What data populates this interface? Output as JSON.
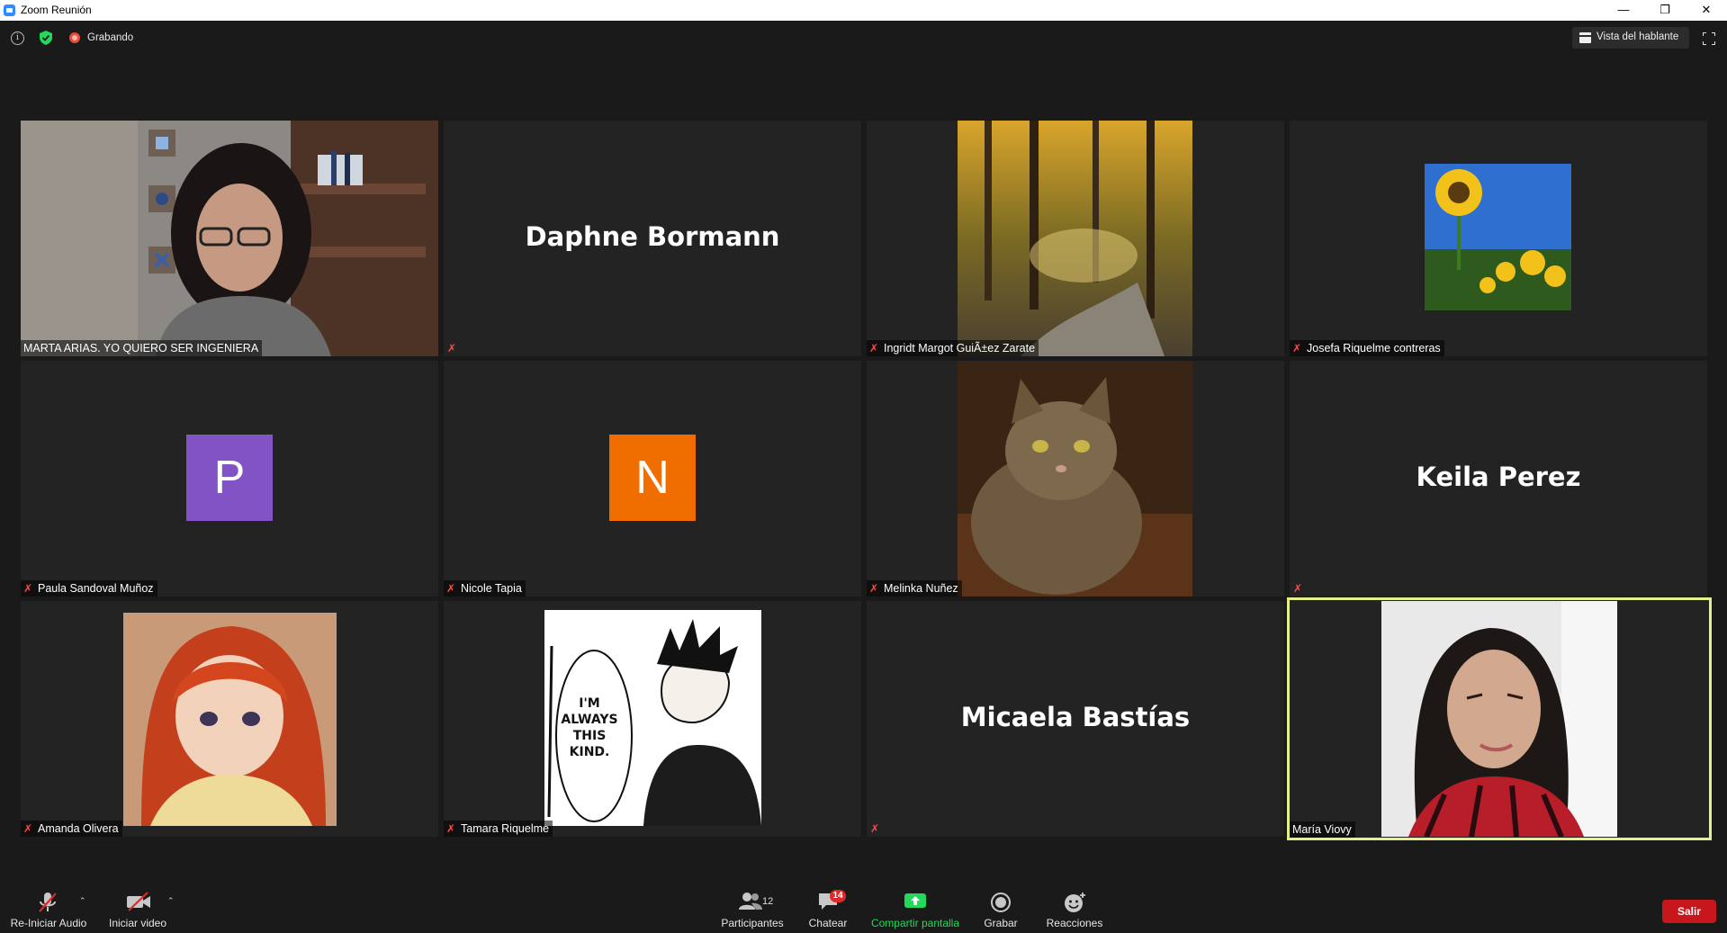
{
  "window": {
    "title": "Zoom Reunión"
  },
  "topbar": {
    "recording_label": "Grabando",
    "view_label": "Vista del hablante"
  },
  "tiles": [
    {
      "caption": "MARTA ARIAS. YO QUIERO SER INGENIERA"
    },
    {
      "big_name": "Daphne Bormann"
    },
    {
      "caption": "Ingridt Margot GuiÃ±ez Zarate"
    },
    {
      "caption": "Josefa Riquelme contreras"
    },
    {
      "avatar_letter": "P",
      "avatar_color": "#8153c4",
      "caption": "Paula Sandoval Muñoz"
    },
    {
      "avatar_letter": "N",
      "avatar_color": "#f06e00",
      "caption": "Nicole Tapia"
    },
    {
      "caption": "Melinka Nuñez"
    },
    {
      "big_name": "Keila Perez"
    },
    {
      "caption": "Amanda Olivera"
    },
    {
      "caption": "Tamara Riquelme",
      "comic_text": [
        "I'M",
        "ALWAYS",
        "THIS",
        "KIND."
      ]
    },
    {
      "big_name": "Micaela Bastías"
    },
    {
      "caption": "María Viovy"
    }
  ],
  "toolbar": {
    "audio_label": "Re-Iniciar Audio",
    "video_label": "Iniciar video",
    "participants_label": "Participantes",
    "participants_count": "12",
    "chat_label": "Chatear",
    "chat_badge": "14",
    "share_label": "Compartir pantalla",
    "record_label": "Grabar",
    "reactions_label": "Reacciones",
    "leave_label": "Salir"
  },
  "colors": {
    "accent_green": "#23d959",
    "leave_red": "#c8161d",
    "active_speaker": "#e4f08a",
    "mute_red": "#ff4a4a"
  }
}
